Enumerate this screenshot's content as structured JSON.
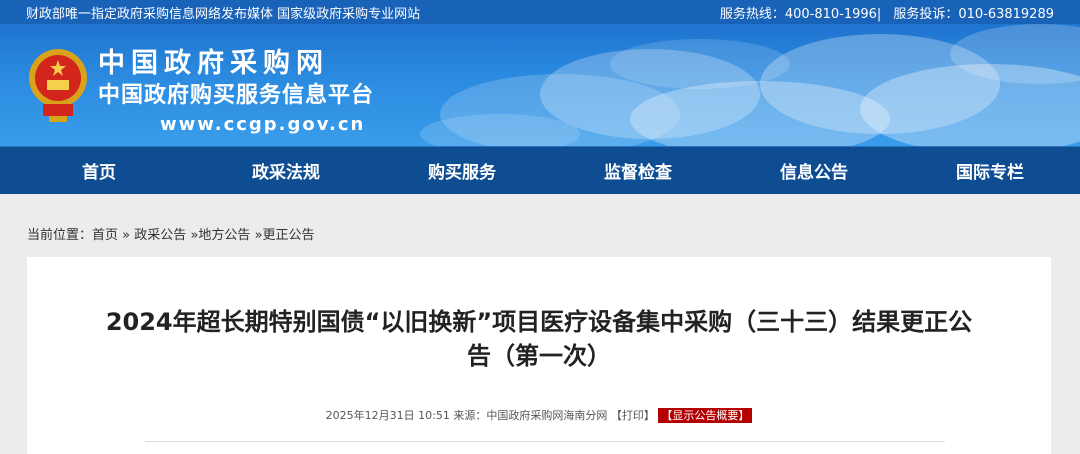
{
  "topbar": {
    "left_text": "财政部唯一指定政府采购信息网络发布媒体 国家级政府采购专业网站",
    "hotline": "服务热线：400-810-1996",
    "separator": "|",
    "complaint": "服务投诉：010-63819289"
  },
  "header": {
    "logo_title": "中国政府采购网",
    "logo_subtitle": "中国政府购买服务信息平台",
    "logo_url": "www.ccgp.gov.cn"
  },
  "nav": {
    "items": [
      "首页",
      "政采法规",
      "购买服务",
      "监督检查",
      "信息公告",
      "国际专栏"
    ]
  },
  "breadcrumb": {
    "prefix": "当前位置：",
    "items": [
      "首页",
      "政采公告",
      "地方公告",
      "更正公告"
    ],
    "separator": "»"
  },
  "article": {
    "title_line1": "2024年超长期特别国债“以旧换新”项目医疗设备集中采购（三十三）结果更正公",
    "title_line2": "告（第一次）",
    "date": "2025年12月31日 10:51",
    "source": "来源：中国政府采购网海南分网",
    "print_label": "【打印】",
    "summary_label": "【显示公告概要】"
  },
  "colors": {
    "topbar_bg": "#1862b8",
    "nav_bg": "#0f4d93",
    "badge_bg": "#b40000"
  }
}
